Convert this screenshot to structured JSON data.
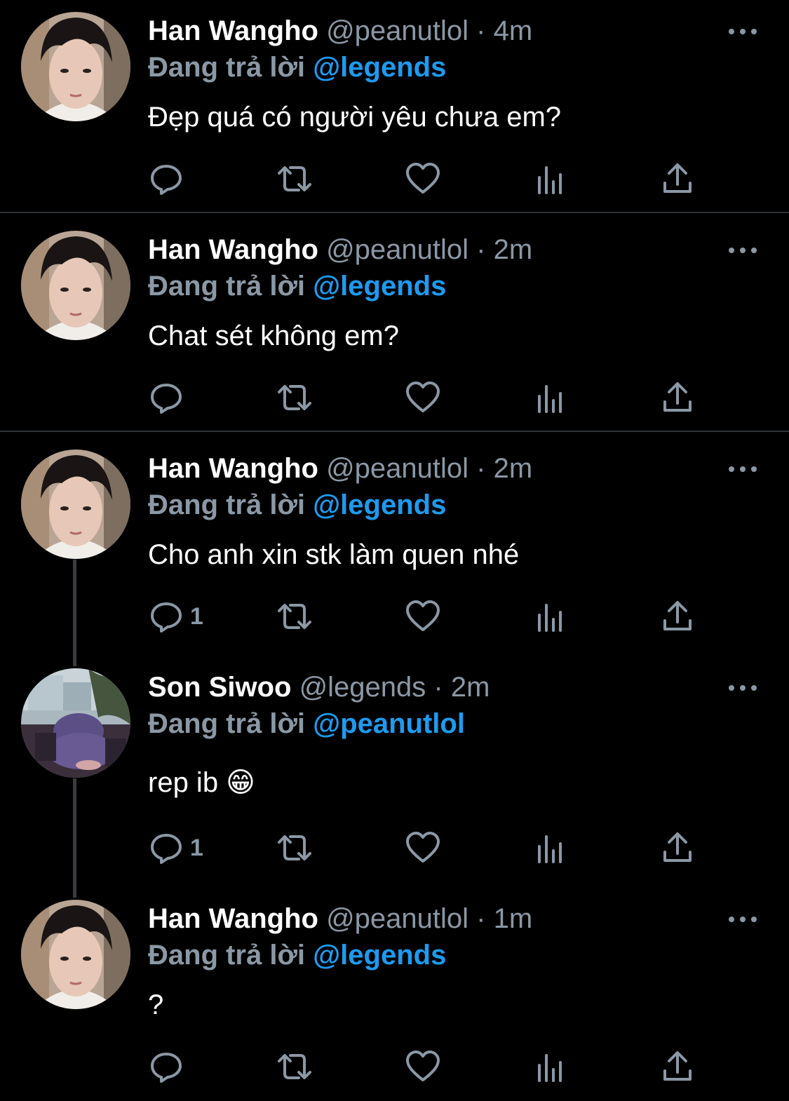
{
  "reply_prefix": "Đang trả lời",
  "tweets": [
    {
      "name": "Han Wangho",
      "handle": "@peanutlol",
      "time": "· 4m",
      "reply_to": "@legends",
      "text": "Đẹp quá có người yêu chưa em?",
      "reply_count": ""
    },
    {
      "name": "Han Wangho",
      "handle": "@peanutlol",
      "time": "· 2m",
      "reply_to": "@legends",
      "text": "Chat sét không em?",
      "reply_count": ""
    },
    {
      "name": "Han Wangho",
      "handle": "@peanutlol",
      "time": "· 2m",
      "reply_to": "@legends",
      "text": "Cho anh xin stk làm quen nhé",
      "reply_count": "1"
    },
    {
      "name": "Son Siwoo",
      "handle": "@legends",
      "time": "· 2m",
      "reply_to": "@peanutlol",
      "text": "rep ib 😁",
      "reply_count": "1"
    },
    {
      "name": "Han Wangho",
      "handle": "@peanutlol",
      "time": "· 1m",
      "reply_to": "@legends",
      "text": "?",
      "reply_count": ""
    }
  ],
  "colors": {
    "background": "#000000",
    "accent": "#1d9bf0",
    "muted": "#8b98a5"
  },
  "icons": [
    "reply-icon",
    "retweet-icon",
    "like-icon",
    "analytics-icon",
    "share-icon",
    "more-icon"
  ]
}
